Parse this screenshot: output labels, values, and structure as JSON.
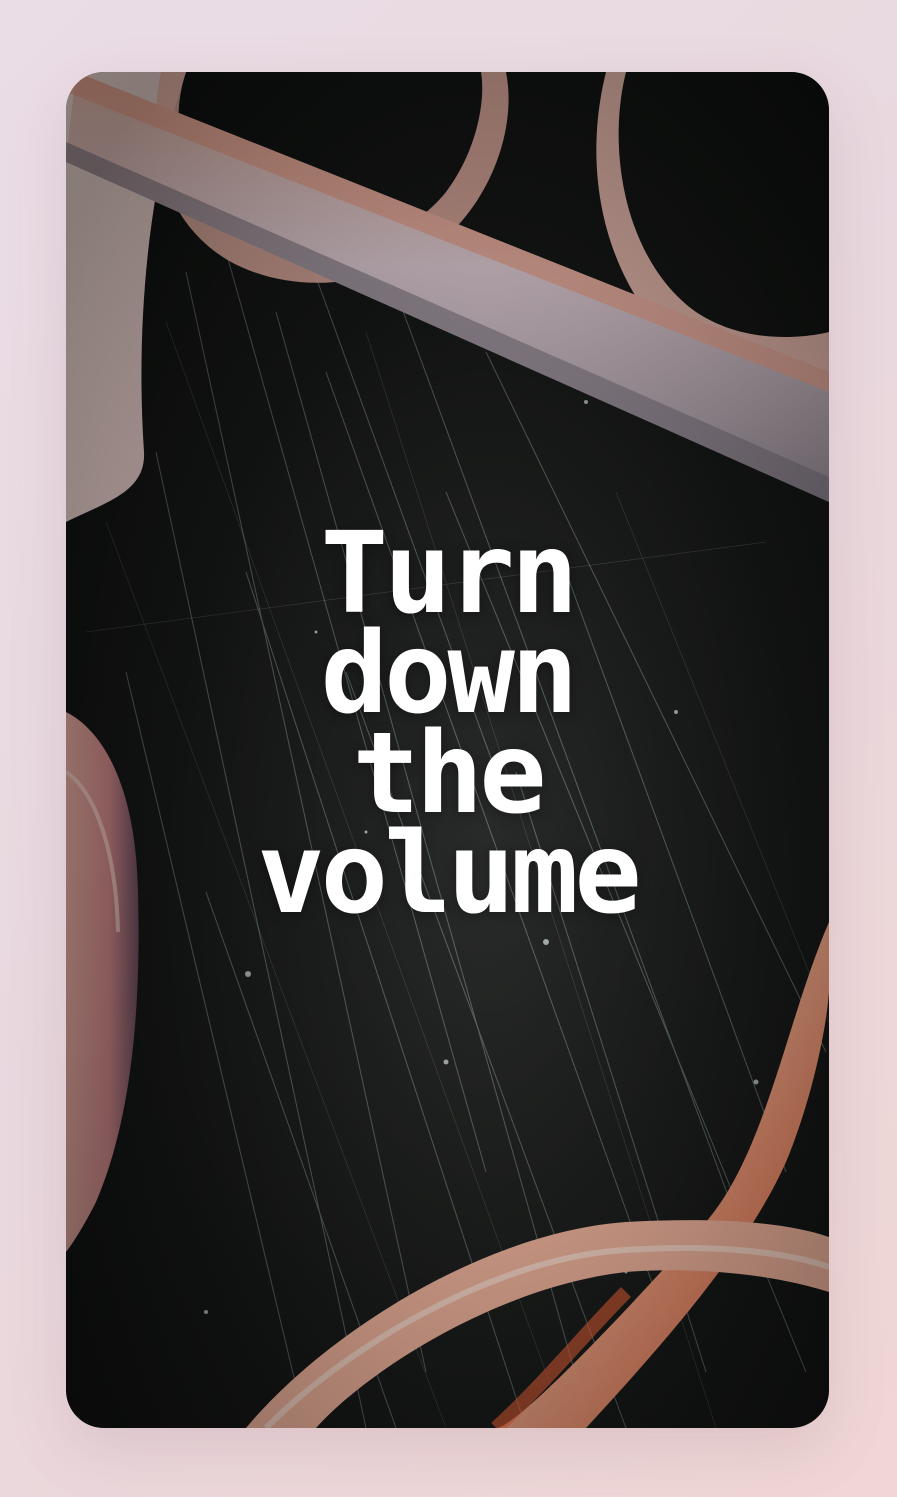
{
  "card": {
    "image": {
      "description_icon": "abstract-photo",
      "colors": {
        "background": "#161817",
        "tube_light": "#e8cfd6",
        "tube_warm": "#f0a68c",
        "accent_orange": "#ff6a3c",
        "scratch": "#cfe6e0"
      }
    },
    "headline": {
      "line1": "Turn",
      "line2": "down",
      "line3": "the",
      "line4": "volume"
    }
  }
}
